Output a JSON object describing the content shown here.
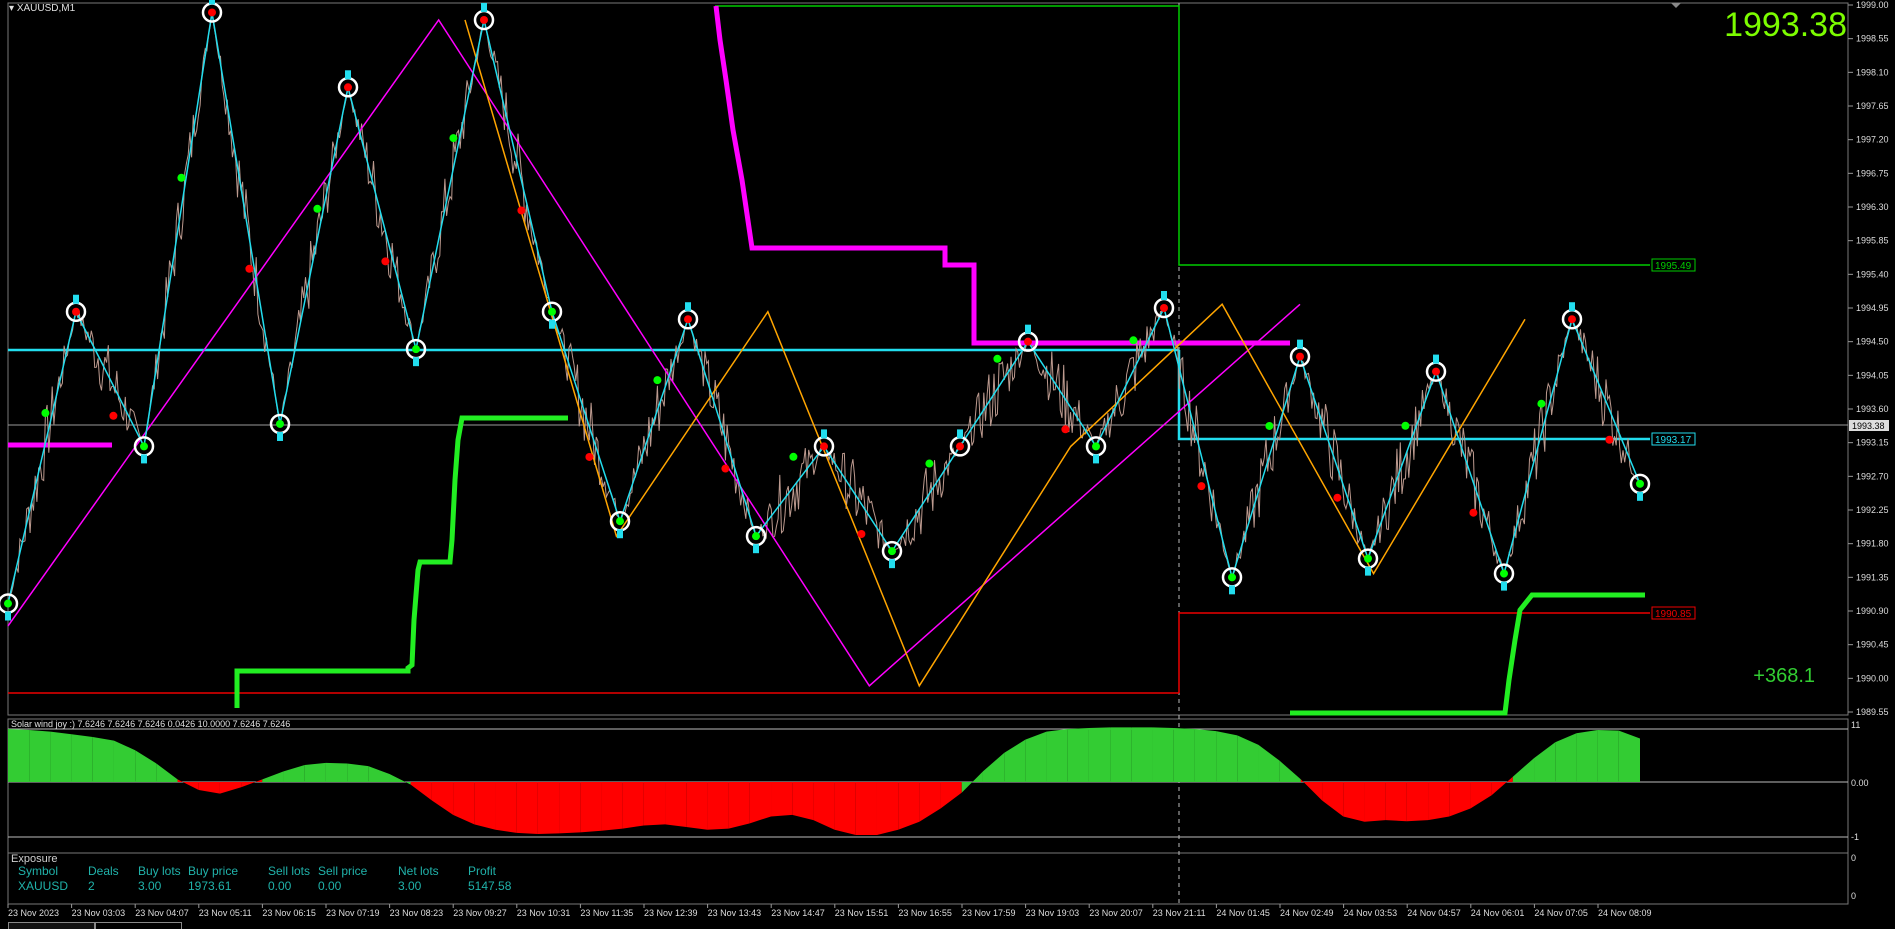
{
  "symbol_title": "XAUUSD,M1",
  "current_price": "1993.38",
  "profit_display": "+368.1",
  "price_axis": {
    "labels": [
      "1999.00",
      "1998.55",
      "1998.10",
      "1997.65",
      "1997.20",
      "1996.75",
      "1996.30",
      "1995.85",
      "1995.40",
      "1994.95",
      "1994.50",
      "1994.05",
      "1993.60",
      "1993.15",
      "1992.70",
      "1992.25",
      "1991.80",
      "1991.35",
      "1990.90",
      "1990.45",
      "1990.00",
      "1989.55"
    ],
    "current_tag": "1993.38",
    "level_tags": {
      "green": "1995.49",
      "cyan": "1993.17",
      "red": "1990.85"
    }
  },
  "time_axis": [
    "23 Nov 2023",
    "23 Nov 03:03",
    "23 Nov 04:07",
    "23 Nov 05:11",
    "23 Nov 06:15",
    "23 Nov 07:19",
    "23 Nov 08:23",
    "23 Nov 09:27",
    "23 Nov 10:31",
    "23 Nov 11:35",
    "23 Nov 12:39",
    "23 Nov 13:43",
    "23 Nov 14:47",
    "23 Nov 15:51",
    "23 Nov 16:55",
    "23 Nov 17:59",
    "23 Nov 19:03",
    "23 Nov 20:07",
    "23 Nov 21:11",
    "24 Nov 01:45",
    "24 Nov 02:49",
    "24 Nov 03:53",
    "24 Nov 04:57",
    "24 Nov 06:01",
    "24 Nov 07:05",
    "24 Nov 08:09"
  ],
  "oscillator": {
    "caption": "Solar wind joy :) 7.6246 7.6246 7.6246 0.0426 10.0000 7.6246 7.6246",
    "axis_labels": {
      "top": "11",
      "zero": "0.00",
      "bottom": "-1"
    },
    "values": [
      1,
      0.98,
      0.95,
      0.9,
      0.85,
      0.78,
      0.6,
      0.35,
      0.05,
      -0.15,
      -0.22,
      -0.1,
      0.05,
      0.2,
      0.32,
      0.36,
      0.35,
      0.3,
      0.15,
      -0.05,
      -0.35,
      -0.62,
      -0.8,
      -0.9,
      -0.96,
      -0.98,
      -0.97,
      -0.95,
      -0.92,
      -0.88,
      -0.82,
      -0.8,
      -0.85,
      -0.9,
      -0.88,
      -0.78,
      -0.65,
      -0.62,
      -0.72,
      -0.9,
      -1.0,
      -1.0,
      -0.9,
      -0.75,
      -0.5,
      -0.2,
      0.2,
      0.55,
      0.8,
      0.95,
      1.0,
      1.02,
      1.03,
      1.03,
      1.03,
      1.02,
      1.0,
      0.96,
      0.88,
      0.7,
      0.4,
      0.05,
      -0.35,
      -0.65,
      -0.75,
      -0.72,
      -0.74,
      -0.72,
      -0.65,
      -0.5,
      -0.25,
      0.1,
      0.45,
      0.75,
      0.92,
      0.98,
      0.97,
      0.82
    ]
  },
  "subwindow": {
    "axis_labels": {
      "top": "0",
      "bottom": "0"
    }
  },
  "exposure": {
    "title": "Exposure",
    "headers": [
      "Symbol",
      "Deals",
      "Buy lots",
      "Buy price",
      "Sell lots",
      "Sell price",
      "Net lots",
      "Profit"
    ],
    "row": [
      "XAUUSD",
      "2",
      "3.00",
      "1973.61",
      "0.00",
      "0.00",
      "3.00",
      "5147.58"
    ]
  },
  "colors": {
    "background": "#000000",
    "price_line": "#bc9a8f",
    "cyan": "#22ddee",
    "magenta": "#ff00ff",
    "orange": "#ffa500",
    "green": "#00ff00",
    "red": "#ff0000",
    "price_text": "#7cfc00"
  },
  "swings": {
    "cyan": [
      1991.0,
      1994.9,
      1993.1,
      1998.9,
      1993.4,
      1997.9,
      1994.4,
      1998.8,
      1994.9,
      1992.1,
      1994.8,
      1991.9,
      1993.1,
      1991.7,
      1993.1,
      1994.5,
      1993.1,
      1994.95,
      1991.35,
      1994.3,
      1991.6,
      1994.1,
      1991.4,
      1994.8,
      1992.6
    ],
    "orange": [
      1998.8,
      1991.9,
      1994.9,
      1989.9,
      1993.1,
      1995.0,
      1991.4,
      1994.8
    ],
    "magenta": [
      1990.7,
      1998.8,
      1989.9,
      1995.0
    ]
  }
}
